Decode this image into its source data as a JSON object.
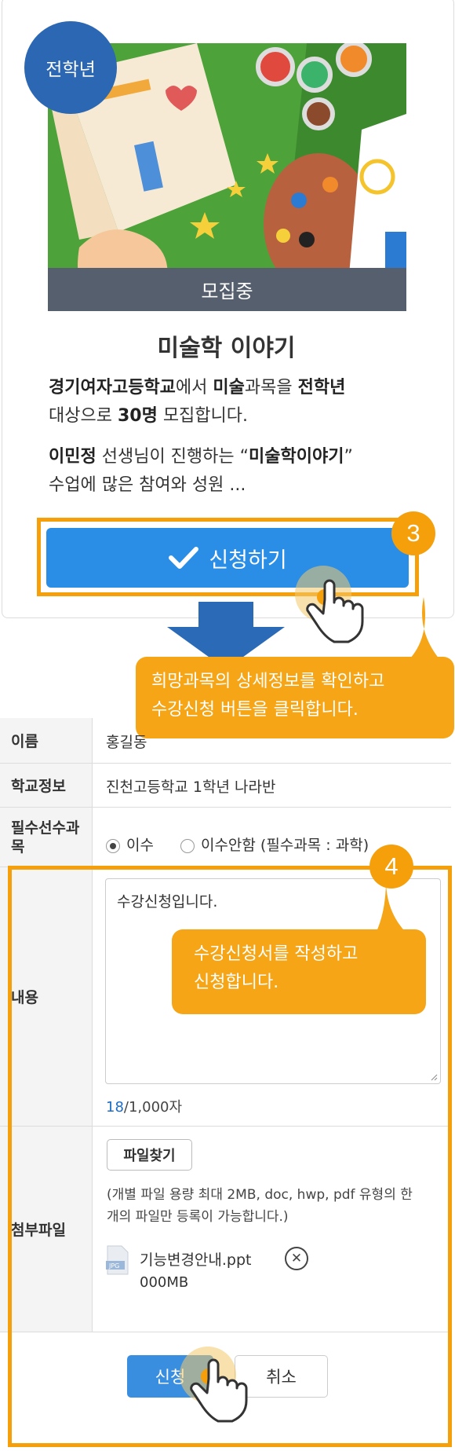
{
  "card": {
    "grade_badge": "전학년",
    "status": "모집중",
    "title": "미술학 이야기",
    "desc1": {
      "school": "경기여자고등학교",
      "t1": "에서 ",
      "subject": "미술",
      "t2": "과목을 ",
      "grade": "전학년",
      "t3": "대상으로 ",
      "count": "30명",
      "t4": " 모집합니다."
    },
    "desc2": {
      "teacher": "이민정",
      "t1": " 선생님이 진행하는 “",
      "course": "미술학이야기",
      "t2": "”",
      "t3": "수업에 많은 참여와 성원 ..."
    },
    "apply_label": "신청하기",
    "step": "3"
  },
  "callouts": {
    "c1_line1": "희망과목의 상세정보를 확인하고",
    "c1_line2": "수강신청 버튼을 클릭합니다.",
    "c2_line1": "수강신청서를 작성하고",
    "c2_line2": "신청합니다.",
    "step": "4"
  },
  "form": {
    "name_label": "이름",
    "name_value": "홍길동",
    "school_label": "학교정보",
    "school_value": "진천고등학교 1학년 나라반",
    "prereq_label_line1": "필수선수과",
    "prereq_label_line2": "목",
    "prereq_opt1": "이수",
    "prereq_opt2": "이수안함 (필수과목 : 과학)",
    "content_label": "내용",
    "content_value": "수강신청입니다.",
    "counter_current": "18",
    "counter_max": "/1,000자",
    "attach_label": "첨부파일",
    "find_button": "파일찾기",
    "hint_line1": "(개별 파일 용량 최대 2MB, doc, hwp, pdf 유형의 한",
    "hint_line2": "개의 파일만 등록이 가능합니다.)",
    "file_name": "기능변경안내.ppt",
    "file_size": "000MB",
    "file_icon_tag": "JPG",
    "submit": "신청",
    "cancel": "취소"
  },
  "colors": {
    "accent_orange": "#f59f0b",
    "button_blue": "#2a8ee6",
    "badge_blue": "#2b67b2",
    "status_gray": "#555f6e"
  },
  "icons": [
    "check-icon",
    "hand-cursor-icon",
    "down-arrow-icon",
    "file-icon",
    "close-icon",
    "radio-icon"
  ]
}
